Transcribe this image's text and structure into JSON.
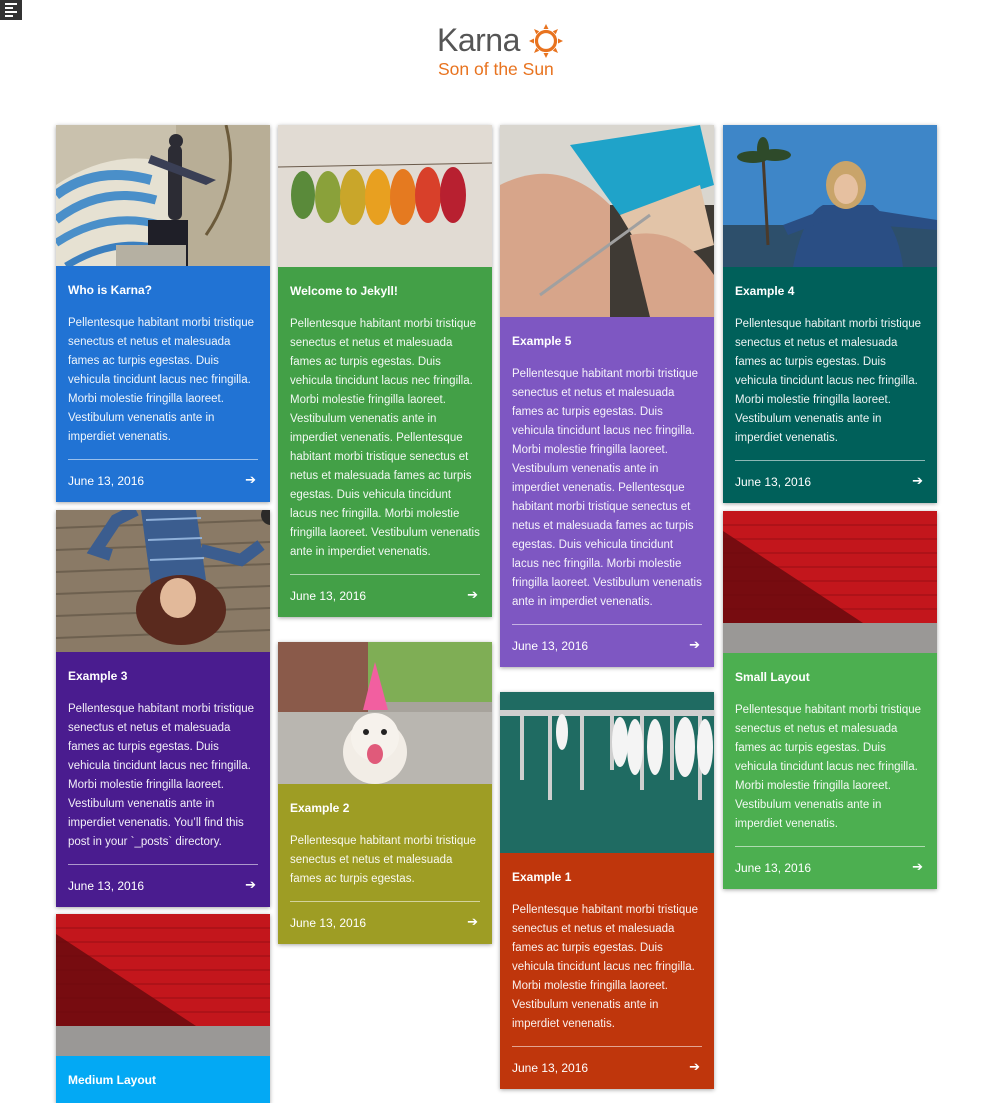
{
  "brand": {
    "name": "Karna",
    "tagline": "Son of the Sun",
    "accent": "#e8731f"
  },
  "menu_icon": "hamburger-menu-icon",
  "cards": [
    {
      "id": "who-is-karna",
      "title": "Who is Karna?",
      "color": "#2173d4",
      "image": "archer-statue",
      "excerpt": "Pellentesque habitant morbi tristique senectus et netus et malesuada fames ac turpis egestas. Duis vehicula tincidunt lacus nec fringilla. Morbi molestie fringilla laoreet. Vestibulum venenatis ante in imperdiet venenatis.",
      "date": "June 13, 2016",
      "arrow": "➔"
    },
    {
      "id": "example-3",
      "title": "Example 3",
      "color": "#4a1c8f",
      "image": "woman-lying-on-deck",
      "excerpt": "Pellentesque habitant morbi tristique senectus et netus et malesuada fames ac turpis egestas. Duis vehicula tincidunt lacus nec fringilla. Morbi molestie fringilla laoreet. Vestibulum venenatis ante in imperdiet venenatis. You’ll find this post in your `_posts` directory.",
      "date": "June 13, 2016",
      "arrow": "➔"
    },
    {
      "id": "medium-layout",
      "title": "Medium Layout",
      "color": "#03a9f4",
      "image": "red-wall",
      "excerpt": "",
      "date": "",
      "arrow": ""
    },
    {
      "id": "welcome-to-jekyll",
      "title": "Welcome to Jekyll!",
      "color": "#43a047",
      "image": "autumn-leaves",
      "excerpt": "Pellentesque habitant morbi tristique senectus et netus et malesuada fames ac turpis egestas. Duis vehicula tincidunt lacus nec fringilla. Morbi molestie fringilla laoreet. Vestibulum venenatis ante in imperdiet venenatis. Pellentesque habitant morbi tristique senectus et netus et malesuada fames ac turpis egestas. Duis vehicula tincidunt lacus nec fringilla. Morbi molestie fringilla laoreet. Vestibulum venenatis ante in imperdiet venenatis.",
      "date": "June 13, 2016",
      "arrow": "➔"
    },
    {
      "id": "example-2",
      "title": "Example 2",
      "color": "#9e9d24",
      "image": "dog-party-hat",
      "excerpt": "Pellentesque habitant morbi tristique senectus et netus et malesuada fames ac turpis egestas.",
      "date": "June 13, 2016",
      "arrow": "➔"
    },
    {
      "id": "example-5",
      "title": "Example 5",
      "color": "#7e57c2",
      "image": "shoemaker-hands",
      "excerpt": "Pellentesque habitant morbi tristique senectus et netus et malesuada fames ac turpis egestas. Duis vehicula tincidunt lacus nec fringilla. Morbi molestie fringilla laoreet. Vestibulum venenatis ante in imperdiet venenatis. Pellentesque habitant morbi tristique senectus et netus et malesuada fames ac turpis egestas. Duis vehicula tincidunt lacus nec fringilla. Morbi molestie fringilla laoreet. Vestibulum venenatis ante in imperdiet venenatis.",
      "date": "June 13, 2016",
      "arrow": "➔"
    },
    {
      "id": "example-1",
      "title": "Example 1",
      "color": "#bf360c",
      "image": "marina-boats",
      "excerpt": "Pellentesque habitant morbi tristique senectus et netus et malesuada fames ac turpis egestas. Duis vehicula tincidunt lacus nec fringilla. Morbi molestie fringilla laoreet. Vestibulum venenatis ante in imperdiet venenatis.",
      "date": "June 13, 2016",
      "arrow": "➔"
    },
    {
      "id": "example-4",
      "title": "Example 4",
      "color": "#00605a",
      "image": "woman-palm-sky",
      "excerpt": "Pellentesque habitant morbi tristique senectus et netus et malesuada fames ac turpis egestas. Duis vehicula tincidunt lacus nec fringilla. Morbi molestie fringilla laoreet. Vestibulum venenatis ante in imperdiet venenatis.",
      "date": "June 13, 2016",
      "arrow": "➔"
    },
    {
      "id": "small-layout",
      "title": "Small Layout",
      "color": "#4caf50",
      "image": "red-wall",
      "excerpt": "Pellentesque habitant morbi tristique senectus et netus et malesuada fames ac turpis egestas. Duis vehicula tincidunt lacus nec fringilla. Morbi molestie fringilla laoreet. Vestibulum venenatis ante in imperdiet venenatis.",
      "date": "June 13, 2016",
      "arrow": "➔"
    }
  ]
}
